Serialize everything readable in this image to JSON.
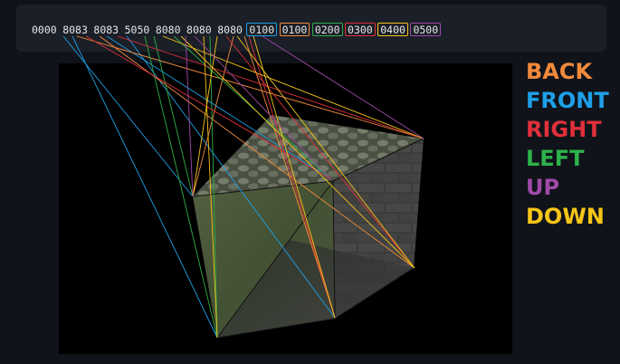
{
  "toolbar": {
    "codes": [
      {
        "text": "0000",
        "boxed": false,
        "color": null
      },
      {
        "text": "8083",
        "boxed": false,
        "color": null
      },
      {
        "text": "8083",
        "boxed": false,
        "color": null
      },
      {
        "text": "5050",
        "boxed": false,
        "color": null
      },
      {
        "text": "8080",
        "boxed": false,
        "color": null
      },
      {
        "text": "8080",
        "boxed": false,
        "color": null
      },
      {
        "text": "8080",
        "boxed": false,
        "color": null
      },
      {
        "text": "0100",
        "boxed": true,
        "color": "#1ea0e8"
      },
      {
        "text": "0100",
        "boxed": true,
        "color": "#f28a3c"
      },
      {
        "text": "0200",
        "boxed": true,
        "color": "#2db24a"
      },
      {
        "text": "0300",
        "boxed": true,
        "color": "#e0303a"
      },
      {
        "text": "0400",
        "boxed": true,
        "color": "#f5c518"
      },
      {
        "text": "0500",
        "boxed": true,
        "color": "#a04aa8"
      }
    ]
  },
  "legend": [
    {
      "label": "BACK",
      "color": "#f28a3c"
    },
    {
      "label": "FRONT",
      "color": "#1ea0e8"
    },
    {
      "label": "RIGHT",
      "color": "#e0303a"
    },
    {
      "label": "LEFT",
      "color": "#2db24a"
    },
    {
      "label": "UP",
      "color": "#a04aa8"
    },
    {
      "label": "DOWN",
      "color": "#f5c518"
    }
  ]
}
